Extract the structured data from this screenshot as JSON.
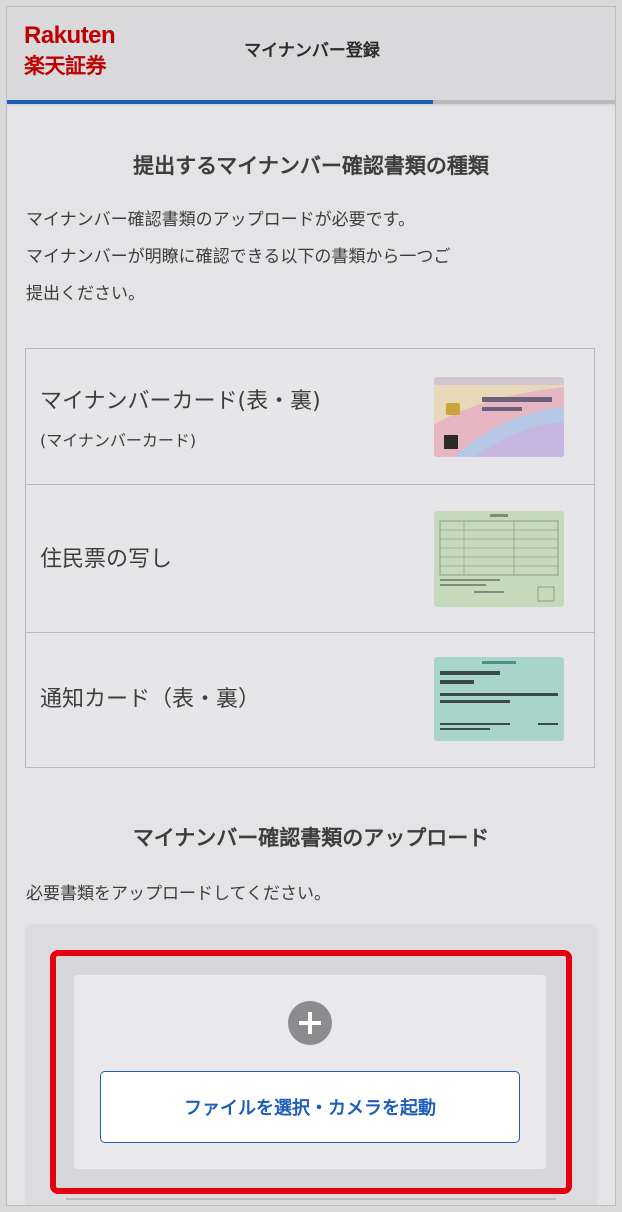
{
  "header": {
    "logo_en": "Rakuten",
    "logo_jp": "楽天証券",
    "title": "マイナンバー登録",
    "progress_fraction": 0.7
  },
  "documents_section": {
    "title": "提出するマイナンバー確認書類の種類",
    "description_lines": [
      "マイナンバー確認書類のアップロードが必要です。",
      "マイナンバーが明瞭に確認できる以下の書類から一つご",
      "提出ください。"
    ],
    "items": [
      {
        "label": "マイナンバーカード(表・裏)",
        "sublabel": "(マイナンバーカード)",
        "icon": "my-number-card-image"
      },
      {
        "label": "住民票の写し",
        "icon": "resident-record-image"
      },
      {
        "label": "通知カード（表・裏）",
        "icon": "notification-card-image"
      }
    ]
  },
  "upload_section": {
    "title": "マイナンバー確認書類のアップロード",
    "description": "必要書類をアップロードしてください。",
    "button_label": "ファイルを選択・カメラを起動",
    "plus_icon": "plus-circle-icon"
  },
  "colors": {
    "brand_red": "#bf0000",
    "accent_blue": "#1f5fb8",
    "highlight_red": "#e4000f"
  }
}
